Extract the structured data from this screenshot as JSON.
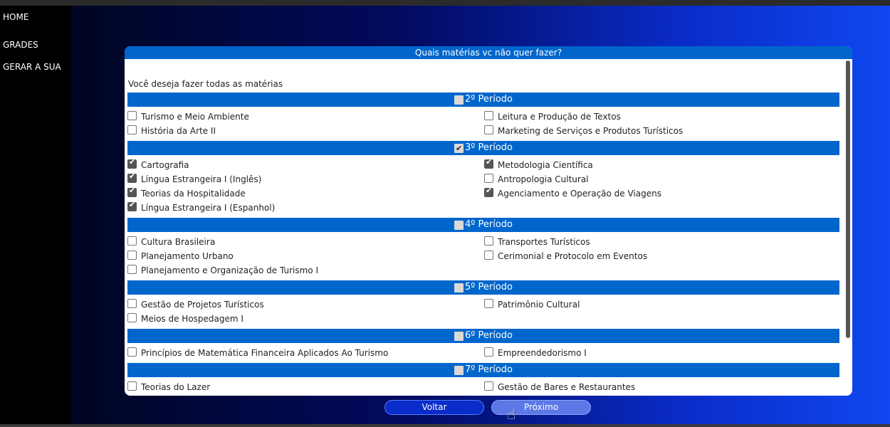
{
  "sidebar": {
    "items": [
      {
        "label": "HOME"
      },
      {
        "label": "GRADES"
      },
      {
        "label": "GERAR A SUA"
      }
    ]
  },
  "modal": {
    "title": "Quais matérias vc não quer fazer?",
    "intro": "Você deseja fazer todas as matérias"
  },
  "periods": [
    {
      "label": "2º Período",
      "checked": false,
      "left": [
        {
          "label": "Turismo e Meio Ambiente",
          "checked": false
        },
        {
          "label": "História da Arte II",
          "checked": false
        }
      ],
      "right": [
        {
          "label": "Leitura e Produção de Textos",
          "checked": false
        },
        {
          "label": "Marketing de Serviços e Produtos Turísticos",
          "checked": false
        }
      ]
    },
    {
      "label": "3º Período",
      "checked": true,
      "left": [
        {
          "label": "Cartografia",
          "checked": true
        },
        {
          "label": "Língua Estrangeira I (Inglês)",
          "checked": true
        },
        {
          "label": "Teorias da Hospitalidade",
          "checked": true
        },
        {
          "label": "Língua Estrangeira I (Espanhol)",
          "checked": true
        }
      ],
      "right": [
        {
          "label": "Metodologia Científica",
          "checked": true
        },
        {
          "label": "Antropologia Cultural",
          "checked": false
        },
        {
          "label": "Agenciamento e Operação de Viagens",
          "checked": true
        }
      ]
    },
    {
      "label": "4º Período",
      "checked": false,
      "left": [
        {
          "label": "Cultura Brasileira",
          "checked": false
        },
        {
          "label": "Planejamento Urbano",
          "checked": false
        },
        {
          "label": "Planejamento e Organização de Turismo I",
          "checked": false
        }
      ],
      "right": [
        {
          "label": "Transportes Turísticos",
          "checked": false
        },
        {
          "label": "Cerimonial e Protocolo em Eventos",
          "checked": false
        }
      ]
    },
    {
      "label": "5º Período",
      "checked": false,
      "left": [
        {
          "label": "Gestão de Projetos Turísticos",
          "checked": false
        },
        {
          "label": "Meios de Hospedagem I",
          "checked": false
        }
      ],
      "right": [
        {
          "label": "Patrimônio Cultural",
          "checked": false
        }
      ]
    },
    {
      "label": "6º Período",
      "checked": false,
      "left": [
        {
          "label": "Princípios de Matemática Financeira Aplicados Ao Turismo",
          "checked": false
        }
      ],
      "right": [
        {
          "label": "Empreendedorismo I",
          "checked": false
        }
      ]
    },
    {
      "label": "7º Período",
      "checked": false,
      "left": [
        {
          "label": "Teorias do Lazer",
          "checked": false
        }
      ],
      "right": [
        {
          "label": "Gestão de Bares e Restaurantes",
          "checked": false
        }
      ]
    }
  ],
  "buttons": {
    "back": "Voltar",
    "next": "Próximo"
  },
  "colors": {
    "accent": "#0066cc",
    "button_back": "#0a2cc8",
    "button_next": "#5b78e6"
  }
}
